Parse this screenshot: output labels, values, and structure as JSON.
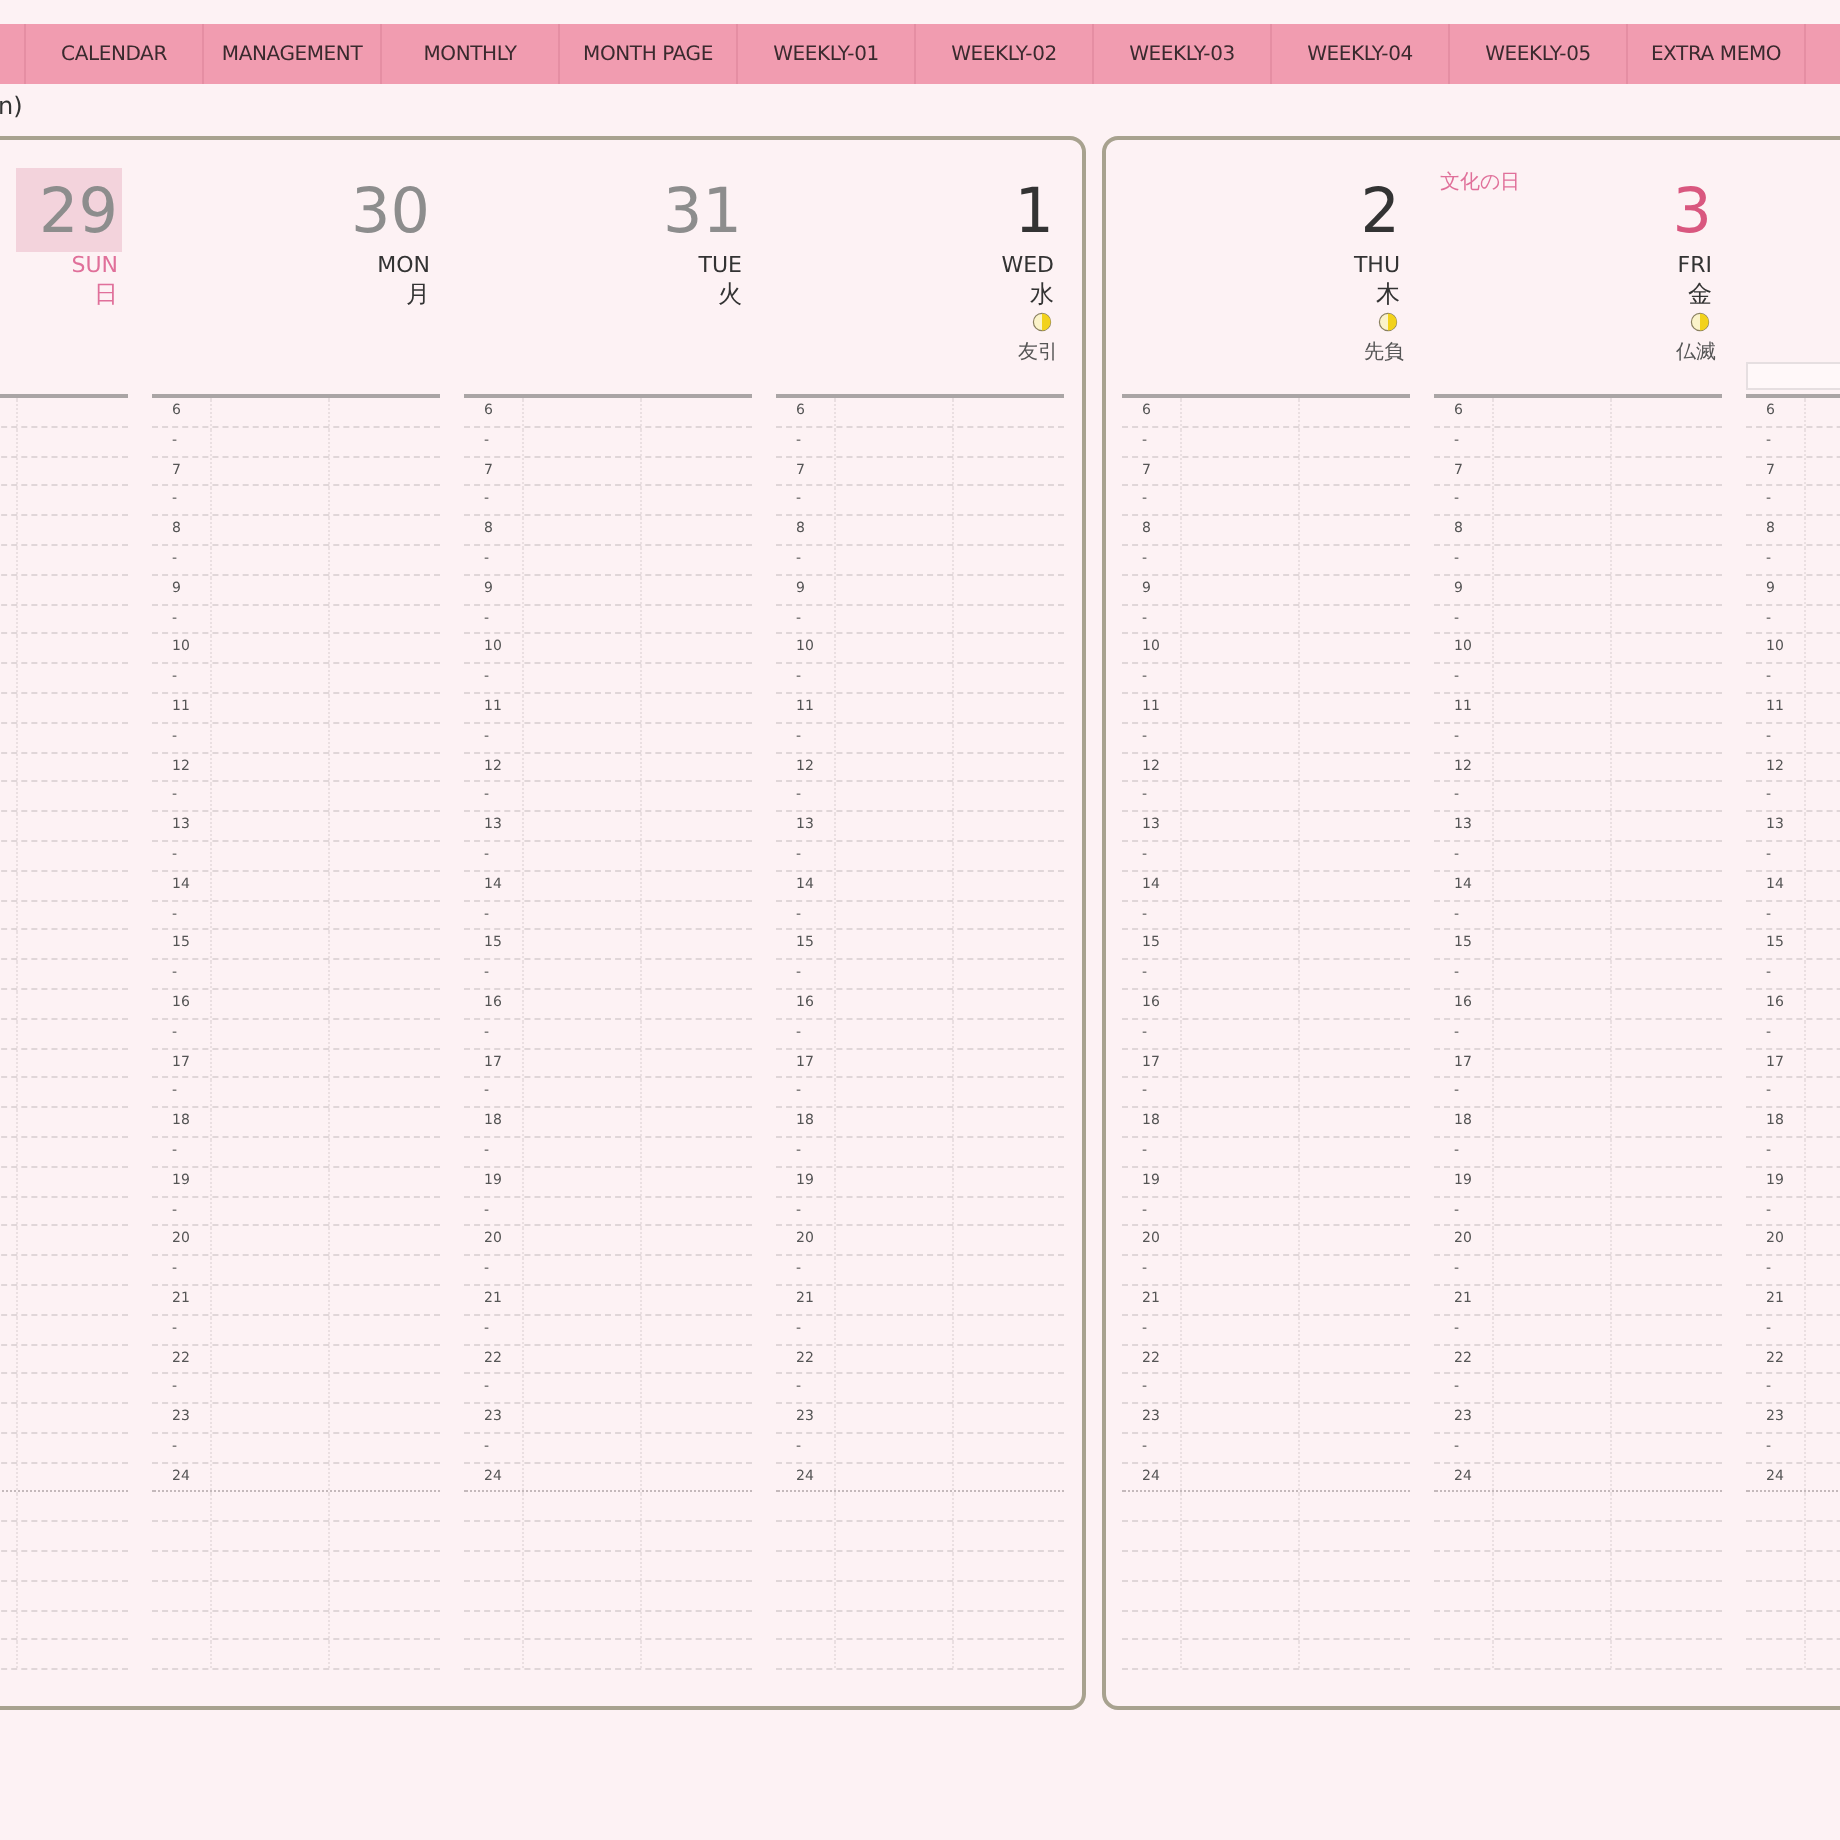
{
  "tabs": [
    {
      "label": "CALENDAR",
      "selected": false
    },
    {
      "label": "MANAGEMENT",
      "selected": false
    },
    {
      "label": "MONTHLY",
      "selected": false
    },
    {
      "label": "MONTH PAGE",
      "selected": false
    },
    {
      "label": "WEEKLY-01",
      "selected": false
    },
    {
      "label": "WEEKLY-02",
      "selected": false
    },
    {
      "label": "WEEKLY-03",
      "selected": false
    },
    {
      "label": "WEEKLY-04",
      "selected": false
    },
    {
      "label": "WEEKLY-05",
      "selected": false
    },
    {
      "label": "EXTRA MEMO",
      "selected": false
    }
  ],
  "caption": "n)",
  "pages": [
    {
      "days": [
        {
          "number": "29",
          "weekday": "SUN",
          "kanji": "日",
          "kind": "sunday",
          "other_month": true,
          "selected": true,
          "moon": false
        },
        {
          "number": "30",
          "weekday": "MON",
          "kanji": "月",
          "kind": "weekday",
          "other_month": true,
          "selected": false,
          "moon": false,
          "slots": [
            "6",
            "-",
            "7",
            "-",
            "8",
            "-",
            "9",
            "-",
            "10",
            "-",
            "11",
            "-",
            "12",
            "-",
            "13",
            "-",
            "14",
            "-",
            "15",
            "-",
            "16",
            "-",
            "17",
            "-",
            "18",
            "-",
            "19",
            "-",
            "20",
            "-",
            "21",
            "-",
            "22",
            "-",
            "23",
            "-",
            "24"
          ]
        },
        {
          "number": "31",
          "weekday": "TUE",
          "kanji": "火",
          "kind": "weekday",
          "other_month": true,
          "selected": false,
          "moon": false,
          "slots": [
            "6",
            "-",
            "7",
            "-",
            "8",
            "-",
            "9",
            "-",
            "10",
            "-",
            "11",
            "-",
            "12",
            "-",
            "13",
            "-",
            "14",
            "-",
            "15",
            "-",
            "16",
            "-",
            "17",
            "-",
            "18",
            "-",
            "19",
            "-",
            "20",
            "-",
            "21",
            "-",
            "22",
            "-",
            "23",
            "-",
            "24"
          ]
        },
        {
          "number": "1",
          "weekday": "WED",
          "kanji": "水",
          "kind": "weekday",
          "other_month": false,
          "selected": false,
          "moon": true,
          "rokuyo": "友引",
          "slots": [
            "6",
            "-",
            "7",
            "-",
            "8",
            "-",
            "9",
            "-",
            "10",
            "-",
            "11",
            "-",
            "12",
            "-",
            "13",
            "-",
            "14",
            "-",
            "15",
            "-",
            "16",
            "-",
            "17",
            "-",
            "18",
            "-",
            "19",
            "-",
            "20",
            "-",
            "21",
            "-",
            "22",
            "-",
            "23",
            "-",
            "24"
          ]
        }
      ]
    },
    {
      "days": [
        {
          "number": "2",
          "weekday": "THU",
          "kanji": "木",
          "kind": "weekday",
          "other_month": false,
          "selected": false,
          "moon": true,
          "rokuyo": "先負",
          "slots": [
            "6",
            "-",
            "7",
            "-",
            "8",
            "-",
            "9",
            "-",
            "10",
            "-",
            "11",
            "-",
            "12",
            "-",
            "13",
            "-",
            "14",
            "-",
            "15",
            "-",
            "16",
            "-",
            "17",
            "-",
            "18",
            "-",
            "19",
            "-",
            "20",
            "-",
            "21",
            "-",
            "22",
            "-",
            "23",
            "-",
            "24"
          ]
        },
        {
          "number": "3",
          "weekday": "FRI",
          "kanji": "金",
          "kind": "holiday",
          "holiday": "文化の日",
          "other_month": false,
          "selected": false,
          "moon": true,
          "rokuyo": "仏滅",
          "slots": [
            "6",
            "-",
            "7",
            "-",
            "8",
            "-",
            "9",
            "-",
            "10",
            "-",
            "11",
            "-",
            "12",
            "-",
            "13",
            "-",
            "14",
            "-",
            "15",
            "-",
            "16",
            "-",
            "17",
            "-",
            "18",
            "-",
            "19",
            "-",
            "20",
            "-",
            "21",
            "-",
            "22",
            "-",
            "23",
            "-",
            "24"
          ]
        },
        {
          "kind": "cut",
          "slots": [
            "6",
            "-",
            "7",
            "-",
            "8",
            "-",
            "9",
            "-",
            "10",
            "-",
            "11",
            "-",
            "12",
            "-",
            "13",
            "-",
            "14",
            "-",
            "15",
            "-",
            "16",
            "-",
            "17",
            "-",
            "18",
            "-",
            "19",
            "-",
            "20",
            "-",
            "21",
            "-",
            "22",
            "-",
            "23",
            "-",
            "24"
          ]
        }
      ]
    }
  ]
}
